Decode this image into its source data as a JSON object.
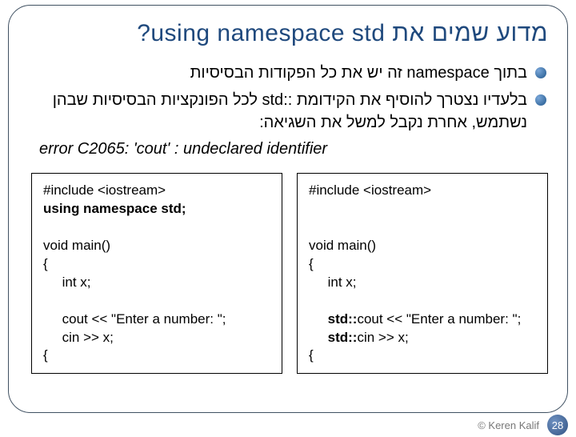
{
  "title": "מדוע שמים את  using namespace std?",
  "bullets": [
    "בתוך namespace זה יש את כל הפקודות הבסיסיות",
    "בלעדיו נצטרך להוסיף את הקידומת ::std לכל הפונקציות הבסיסיות שבהן נשתמש, אחרת נקבל למשל את השגיאה:"
  ],
  "error_line": "error C2065: 'cout' : undeclared identifier",
  "code_left": {
    "l1": "#include <iostream>",
    "l2_bold": "using namespace std;",
    "l3": "",
    "l4": "void main()",
    "l5": "{",
    "l6": "     int x;",
    "l7": "",
    "l8": "     cout << \"Enter a number: \";",
    "l9": "     cin >> x;",
    "l10": "{"
  },
  "code_right": {
    "l1": "#include <iostream>",
    "l2": "",
    "l3": "",
    "l4": "void main()",
    "l5": "{",
    "l6": "     int x;",
    "l7": "",
    "l8_pre": "     ",
    "l8_bold": "std::",
    "l8_post": "cout << \"Enter a number: \";",
    "l9_pre": "     ",
    "l9_bold": "std::",
    "l9_post": "cin >> x;",
    "l10": "{"
  },
  "page_number": "28",
  "copyright": "© Keren Kalif"
}
